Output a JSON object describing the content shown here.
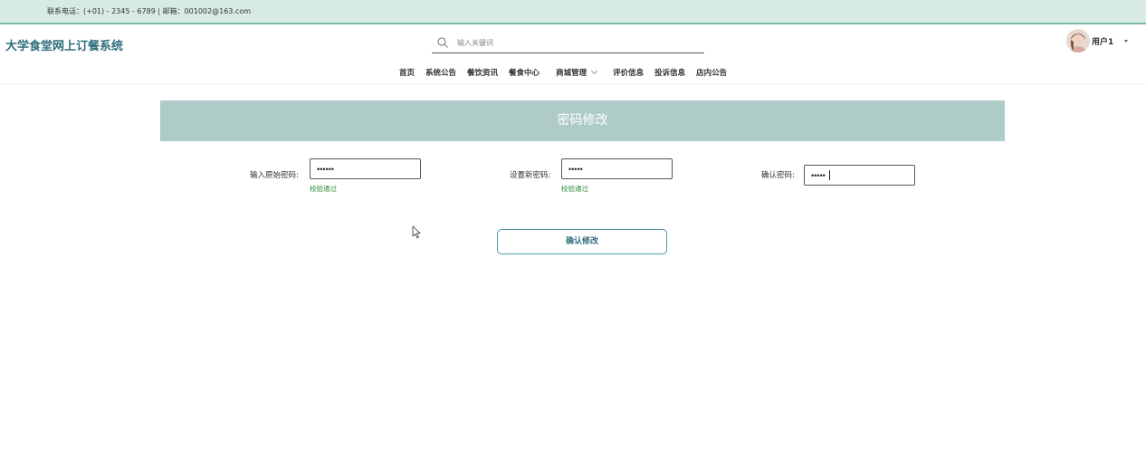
{
  "topbar": {
    "contact": "联系电话：(+01) - 2345 - 6789 | 邮箱：001002@163.com"
  },
  "header": {
    "logo": "大学食堂网上订餐系统",
    "search": {
      "placeholder": "输入关键词",
      "icon": "search-icon"
    },
    "nav": [
      {
        "label": "首页"
      },
      {
        "label": "系统公告"
      },
      {
        "label": "餐饮资讯"
      },
      {
        "label": "餐食中心"
      },
      {
        "label": "商城管理",
        "dropdown": true
      },
      {
        "label": "评价信息"
      },
      {
        "label": "投诉信息"
      },
      {
        "label": "店内公告"
      }
    ],
    "user": {
      "name": "用户1"
    }
  },
  "form": {
    "title": "密码修改",
    "fields": [
      {
        "label": "输入原始密码:",
        "value": "••••••",
        "hint": "校验通过"
      },
      {
        "label": "设置新密码:",
        "value": "•••••",
        "hint": "校验通过"
      },
      {
        "label": "确认密码:",
        "value": "•••••"
      }
    ],
    "submit": "确认修改"
  },
  "colors": {
    "accent": "#2f6e7d",
    "topbar_bg": "#d7ebe3",
    "panel_head": "#aecbc7",
    "hint_ok": "#2e8b3a"
  }
}
